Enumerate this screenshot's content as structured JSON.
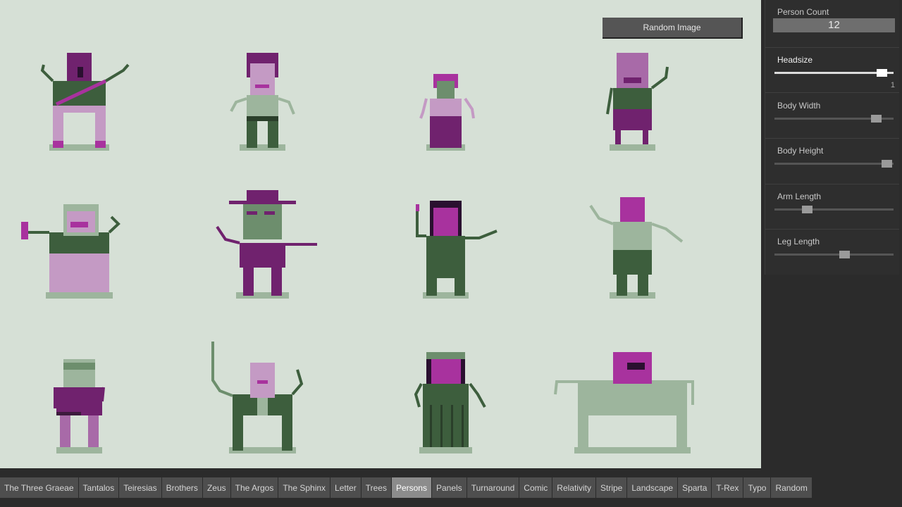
{
  "toolbar": {
    "random_image_label": "Random Image"
  },
  "controls": {
    "person_count": {
      "label": "Person Count",
      "value": "12"
    },
    "headsize": {
      "label": "Headsize",
      "value": "1",
      "level": 0.94
    },
    "body_width": {
      "label": "Body Width",
      "level": 0.89
    },
    "body_height": {
      "label": "Body Height",
      "level": 0.99
    },
    "arm_length": {
      "label": "Arm Length",
      "level": 0.25
    },
    "leg_length": {
      "label": "Leg Length",
      "level": 0.6
    }
  },
  "tabs": [
    "The Three Graeae",
    "Tantalos",
    "Teiresias",
    "Brothers",
    "Zeus",
    "The Argos",
    "The Sphinx",
    "Letter",
    "Trees",
    "Persons",
    "Panels",
    "Turnaround",
    "Comic",
    "Relativity",
    "Stripe",
    "Landscape",
    "Sparta",
    "T-Rex",
    "Typo",
    "Random"
  ],
  "active_tab": "Persons",
  "colors": {
    "canvas_bg": "#d6e0d6",
    "light_green": "#9db59d",
    "dark_green": "#3d5e3d",
    "purple": "#70226e",
    "magenta": "#a8329e",
    "pink": "#c49ac4"
  }
}
